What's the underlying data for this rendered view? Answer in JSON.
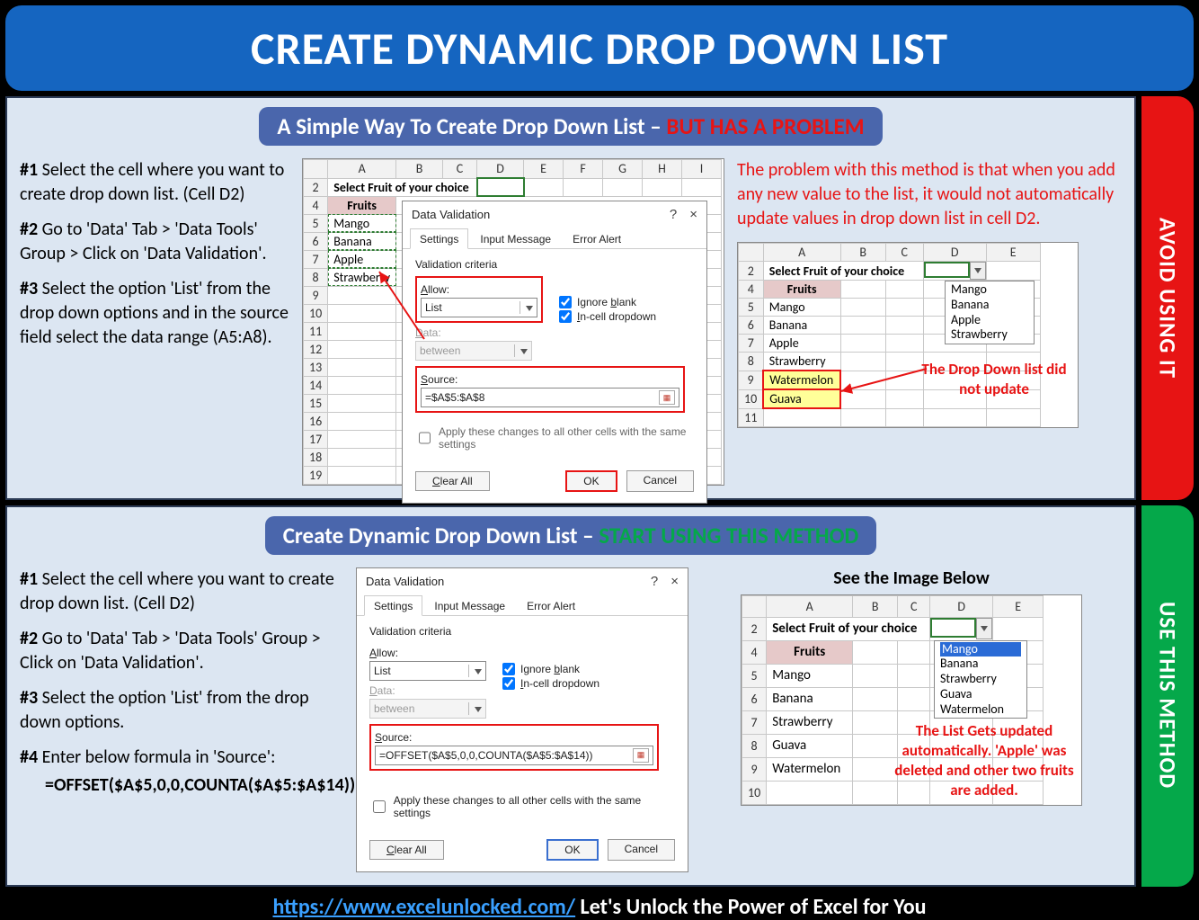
{
  "title": "CREATE DYNAMIC DROP DOWN LIST",
  "footer": {
    "url": "https://www.excelunlocked.com/",
    "tagline": " Let's Unlock the Power of Excel for You"
  },
  "section1": {
    "heading_white": "A Simple Way To Create Drop Down List – ",
    "heading_red": "BUT HAS A PROBLEM",
    "side_tab": "AVOID USING IT",
    "steps": {
      "s1": "Select the cell where you want to create drop down list. (Cell D2)",
      "s2": "Go to 'Data' Tab > 'Data Tools' Group > Click on 'Data Validation'.",
      "s3": "Select the option 'List' from the drop down options and in the source field select the data range (A5:A8)."
    },
    "grid": {
      "cols": [
        "A",
        "B",
        "C",
        "D",
        "E",
        "F",
        "G",
        "H",
        "I"
      ],
      "prompt_row": 2,
      "prompt": "Select Fruit of your choice",
      "header_label": "Fruits",
      "fruits": [
        "Mango",
        "Banana",
        "Apple",
        "Strawberry"
      ]
    },
    "dialog": {
      "title": "Data Validation",
      "tabs": [
        "Settings",
        "Input Message",
        "Error Alert"
      ],
      "legend": "Validation criteria",
      "allow_label": "Allow:",
      "allow_value": "List",
      "data_label": "Data:",
      "data_value": "between",
      "ignore_blank": "Ignore blank",
      "in_cell": "In-cell dropdown",
      "source_label": "Source:",
      "source_value": "=$A$5:$A$8",
      "apply": "Apply these changes to all other cells with the same settings",
      "clear": "Clear All",
      "ok": "OK",
      "cancel": "Cancel"
    },
    "problem_text": "The problem with this method is that when you add any new value to the list, it would not automatically update values in drop down list in cell D2.",
    "result_grid": {
      "cols": [
        "A",
        "B",
        "C",
        "D",
        "E"
      ],
      "prompt": "Select Fruit of your choice",
      "header_label": "Fruits",
      "fruits": [
        "Mango",
        "Banana",
        "Apple",
        "Strawberry",
        "Watermelon",
        "Guava"
      ],
      "dropdown_items": [
        "Mango",
        "Banana",
        "Apple",
        "Strawberry"
      ],
      "note": "The Drop Down list did not update"
    }
  },
  "section2": {
    "heading_white": "Create Dynamic Drop Down List – ",
    "heading_green": "START USING THIS METHOD",
    "side_tab": "USE THIS METHOD",
    "steps": {
      "s1": "Select the cell where you want to create drop down list. (Cell D2)",
      "s2": "Go to 'Data' Tab > 'Data Tools' Group > Click on 'Data Validation'.",
      "s3": "Select the option 'List' from the drop down options.",
      "s4": "Enter below formula in 'Source':",
      "formula": "=OFFSET($A$5,0,0,COUNTA($A$5:$A$14))"
    },
    "dialog": {
      "title": "Data Validation",
      "tabs": [
        "Settings",
        "Input Message",
        "Error Alert"
      ],
      "legend": "Validation criteria",
      "allow_label": "Allow:",
      "allow_value": "List",
      "data_label": "Data:",
      "data_value": "between",
      "ignore_blank": "Ignore blank",
      "in_cell": "In-cell dropdown",
      "source_label": "Source:",
      "source_value": "=OFFSET($A$5,0,0,COUNTA($A$5:$A$14))",
      "apply": "Apply these changes to all other cells with the same settings",
      "clear": "Clear All",
      "ok": "OK",
      "cancel": "Cancel"
    },
    "caption": "See the Image Below",
    "result_grid": {
      "cols": [
        "A",
        "B",
        "C",
        "D",
        "E"
      ],
      "prompt": "Select Fruit of your choice",
      "header_label": "Fruits",
      "fruits": [
        "Mango",
        "Banana",
        "Strawberry",
        "Guava",
        "Watermelon"
      ],
      "dropdown_items": [
        "Mango",
        "Banana",
        "Strawberry",
        "Guava",
        "Watermelon"
      ],
      "note": "The List Gets updated automatically. 'Apple' was deleted and other two fruits are added."
    }
  }
}
